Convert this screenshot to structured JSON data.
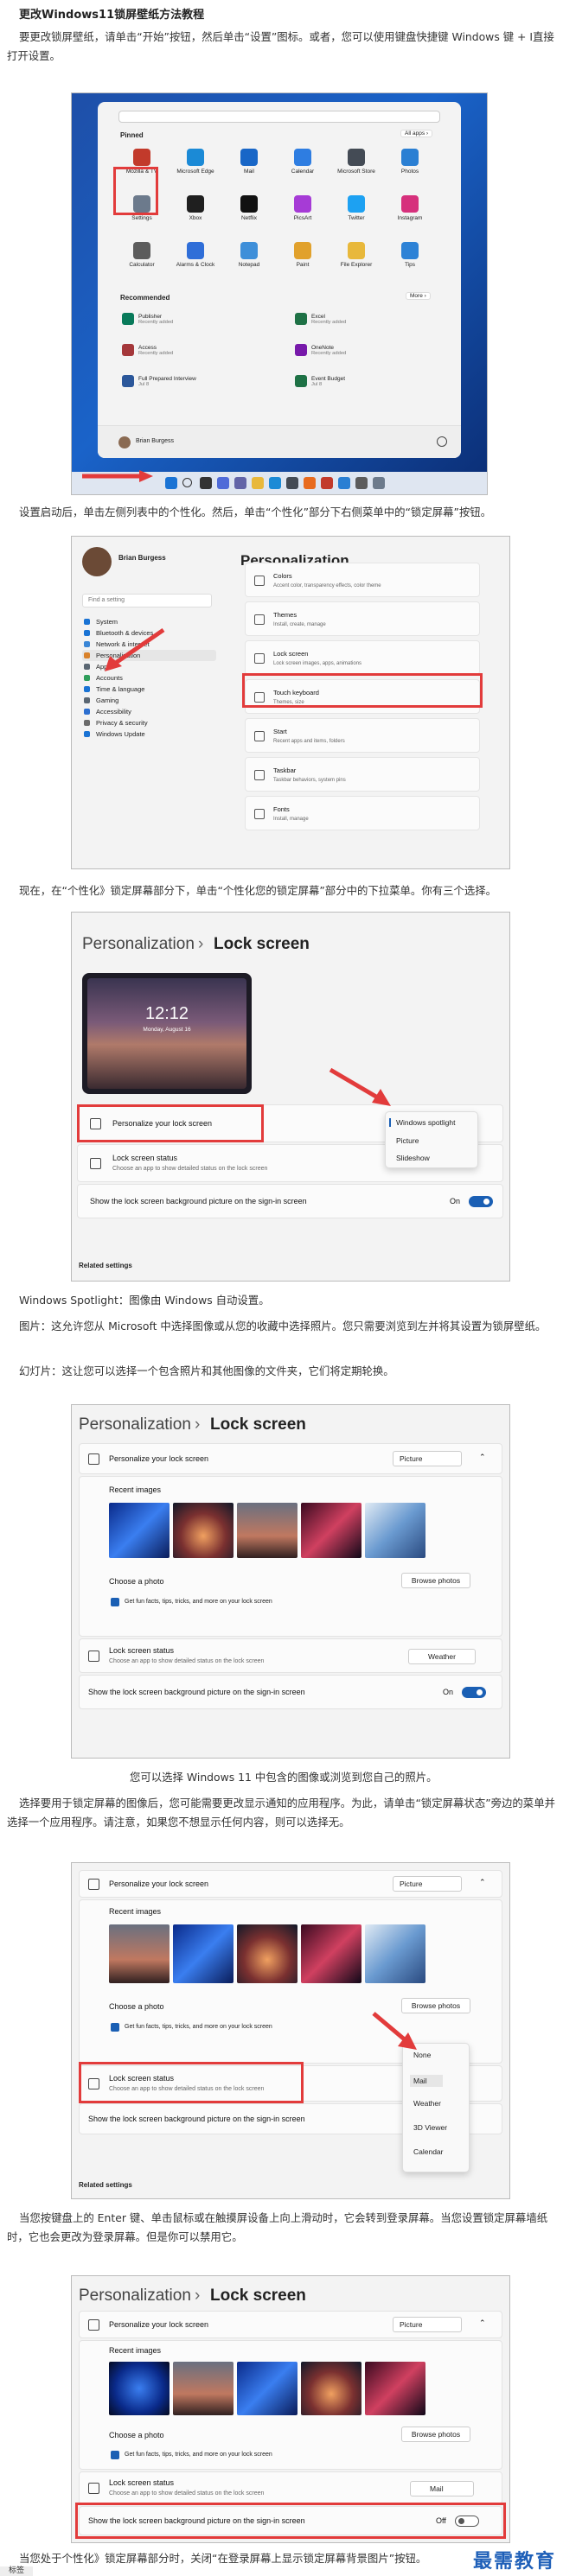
{
  "article": {
    "title": "更改Windows11锁屏壁纸方法教程",
    "p1": "要更改锁屏壁纸，请单击“开始”按钮，然后单击“设置”图标。或者，您可以使用键盘快捷键 Windows 键 + I直接打开设置。",
    "p2": "设置启动后，单击左侧列表中的个性化。然后，单击“个性化”部分下右侧菜单中的“锁定屏幕”按钮。",
    "p3": "现在，在“个性化》锁定屏幕部分下，单击“个性化您的锁定屏幕”部分中的下拉菜单。你有三个选择。",
    "p4": "Windows Spotlight：图像由 Windows 自动设置。",
    "p5": "图片：这允许您从 Microsoft 中选择图像或从您的收藏中选择照片。您只需要浏览到左并将其设置为锁屏壁纸。",
    "p6": "幻灯片：这让您可以选择一个包含照片和其他图像的文件夹，它们将定期轮换。",
    "p7": "您可以选择 Windows 11 中包含的图像或浏览到您自己的照片。",
    "p8": "选择要用于锁定屏幕的图像后，您可能需要更改显示通知的应用程序。为此，请单击“锁定屏幕状态”旁边的菜单并选择一个应用程序。请注意，如果您不想显示任何内容，则可以选择无。",
    "p9": "当您按键盘上的 Enter 键、单击鼠标或在触摸屏设备上向上滑动时，它会转到登录屏幕。当您设置锁定屏幕墙纸时，它也会更改为登录屏幕。但是你可以禁用它。",
    "p10": "当您处于个性化》锁定屏幕部分时，关闭“在登录屏幕上显示锁定屏幕背景图片”按钮。",
    "tag": "标签",
    "watermark": "最需教育"
  },
  "start_menu": {
    "search_placeholder": "",
    "pinned_label": "Pinned",
    "all_apps": "All apps  ›",
    "apps": [
      {
        "label": "Mozilla & TV",
        "color": "#c23a2b"
      },
      {
        "label": "Microsoft Edge",
        "color": "#1b8ad6"
      },
      {
        "label": "Mail",
        "color": "#1866c7"
      },
      {
        "label": "Calendar",
        "color": "#2e7de1"
      },
      {
        "label": "Microsoft Store",
        "color": "#444b55"
      },
      {
        "label": "Photos",
        "color": "#2a7fd3"
      },
      {
        "label": "Settings",
        "color": "#6c7a8c"
      },
      {
        "label": "Xbox",
        "color": "#1f1f1f"
      },
      {
        "label": "Netflix",
        "color": "#111111"
      },
      {
        "label": "PicsArt",
        "color": "#a63bd6"
      },
      {
        "label": "Twitter",
        "color": "#1da1f2"
      },
      {
        "label": "Instagram",
        "color": "#d6307c"
      },
      {
        "label": "Calculator",
        "color": "#5c5c5c"
      },
      {
        "label": "Alarms & Clock",
        "color": "#2f6ed8"
      },
      {
        "label": "Notepad",
        "color": "#3e8fd9"
      },
      {
        "label": "Paint",
        "color": "#e1a12c"
      },
      {
        "label": "File Explorer",
        "color": "#e8b83b"
      },
      {
        "label": "Tips",
        "color": "#2d82d6"
      }
    ],
    "recommended_label": "Recommended",
    "more": "More  ›",
    "recommended": [
      {
        "name": "Publisher",
        "sub": "Recently added",
        "color": "#087a5a"
      },
      {
        "name": "Excel",
        "sub": "Recently added",
        "color": "#1e7145"
      },
      {
        "name": "Access",
        "sub": "Recently added",
        "color": "#a4373a"
      },
      {
        "name": "OneNote",
        "sub": "Recently added",
        "color": "#7719aa"
      },
      {
        "name": "Full Prepared Interview",
        "sub": "Jul 8",
        "color": "#2b579a"
      },
      {
        "name": "Event Budget",
        "sub": "Jul 8",
        "color": "#1e7145"
      }
    ],
    "user": "Brian Burgess"
  },
  "settings1": {
    "user": "Brian Burgess",
    "search_placeholder": "Find a setting",
    "page_title": "Personalization",
    "nav": [
      "System",
      "Bluetooth & devices",
      "Network & internet",
      "Personalization",
      "Apps",
      "Accounts",
      "Time & language",
      "Gaming",
      "Accessibility",
      "Privacy & security",
      "Windows Update"
    ],
    "nav_colors": [
      "#1a73d4",
      "#1a73d4",
      "#3a86d6",
      "#d9822b",
      "#5b6773",
      "#2f9e5b",
      "#1a73d4",
      "#5b6773",
      "#2d6fd0",
      "#6b6b6b",
      "#1a73d4"
    ],
    "cards": [
      {
        "t": "Colors",
        "s": "Accent color, transparency effects, color theme"
      },
      {
        "t": "Themes",
        "s": "Install, create, manage"
      },
      {
        "t": "Lock screen",
        "s": "Lock screen images, apps, animations"
      },
      {
        "t": "Touch keyboard",
        "s": "Themes, size"
      },
      {
        "t": "Start",
        "s": "Recent apps and items, folders"
      },
      {
        "t": "Taskbar",
        "s": "Taskbar behaviors, system pins"
      },
      {
        "t": "Fonts",
        "s": "Install, manage"
      }
    ]
  },
  "lock1": {
    "crumb": "Personalization",
    "title": "Lock screen",
    "time": "12:12",
    "date": "Monday, August 16",
    "row1": "Personalize your lock screen",
    "row2": "Lock screen status",
    "row2_sub": "Choose an app to show detailed status on the lock screen",
    "row3": "Show the lock screen background picture on the sign-in screen",
    "on": "On",
    "menu": [
      "Windows spotlight",
      "Picture",
      "Slideshow"
    ],
    "related": "Related settings"
  },
  "lock2": {
    "crumb": "Personalization",
    "title": "Lock screen",
    "row1": "Personalize your lock screen",
    "dd": "Picture",
    "recent": "Recent images",
    "choose": "Choose a photo",
    "browse": "Browse photos",
    "fun": "Get fun facts, tips, tricks, and more on your lock screen",
    "row2": "Lock screen status",
    "row2_sub": "Choose an app to show detailed status on the lock screen",
    "weather": "Weather",
    "row3": "Show the lock screen background picture on the sign-in screen",
    "on": "On"
  },
  "lock3": {
    "row1": "Personalize your lock screen",
    "dd": "Picture",
    "recent": "Recent images",
    "choose": "Choose a photo",
    "browse": "Browse photos",
    "fun": "Get fun facts, tips, tricks, and more on your lock screen",
    "row2": "Lock screen status",
    "row2_sub": "Choose an app to show detailed status on the lock screen",
    "row3": "Show the lock screen background picture on the sign-in screen",
    "menu": [
      "None",
      "Mail",
      "Weather",
      "3D Viewer",
      "Calendar"
    ],
    "related": "Related settings"
  },
  "lock4": {
    "crumb": "Personalization",
    "title": "Lock screen",
    "row1": "Personalize your lock screen",
    "dd": "Picture",
    "recent": "Recent images",
    "choose": "Choose a photo",
    "browse": "Browse photos",
    "fun": "Get fun facts, tips, tricks, and more on your lock screen",
    "row2": "Lock screen status",
    "row2_sub": "Choose an app to show detailed status on the lock screen",
    "mail": "Mail",
    "row3": "Show the lock screen background picture on the sign-in screen",
    "off": "Off"
  }
}
